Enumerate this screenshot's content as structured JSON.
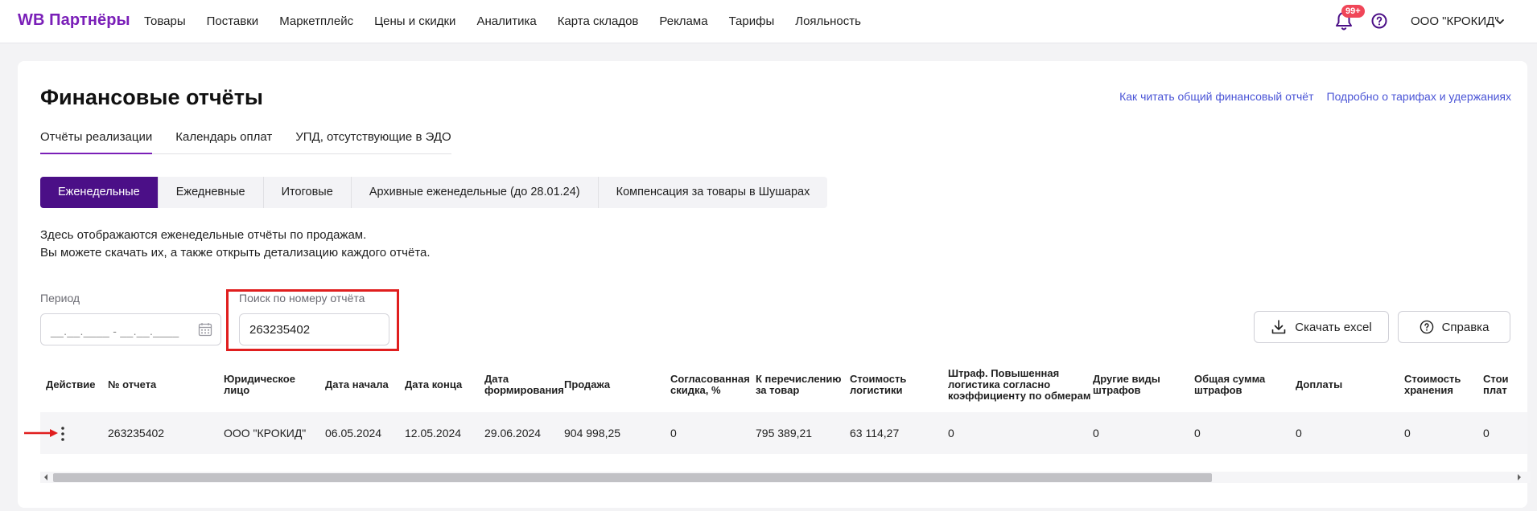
{
  "brand": "WB Партнёры",
  "nav": [
    "Товары",
    "Поставки",
    "Маркетплейс",
    "Цены и скидки",
    "Аналитика",
    "Карта складов",
    "Реклама",
    "Тарифы",
    "Лояльность"
  ],
  "header": {
    "notifications_badge": "99+",
    "account": "ООО \"КРОКИД\""
  },
  "page": {
    "title": "Финансовые отчёты",
    "links": [
      "Как читать общий финансовый отчёт",
      "Подробно о тарифах и удержаниях"
    ],
    "tabs": [
      "Отчёты реализации",
      "Календарь оплат",
      "УПД, отсутствующие в ЭДО"
    ],
    "segments": [
      "Еженедельные",
      "Ежедневные",
      "Итоговые",
      "Архивные еженедельные (до 28.01.24)",
      "Компенсация за товары в Шушарах"
    ],
    "description": [
      "Здесь отображаются еженедельные отчёты по продажам.",
      "Вы можете скачать их, а также открыть детализацию каждого отчёта."
    ]
  },
  "filters": {
    "period_label": "Период",
    "period_value": "__.__.____ - __.__.____",
    "search_label": "Поиск по номеру отчёта",
    "search_value": "263235402"
  },
  "buttons": {
    "download": "Скачать excel",
    "help": "Справка"
  },
  "table": {
    "headers": [
      [
        "Действие"
      ],
      [
        "№ отчета"
      ],
      [
        "Юридическое",
        "лицо"
      ],
      [
        "Дата начала"
      ],
      [
        "Дата конца"
      ],
      [
        "Дата",
        "формирования"
      ],
      [
        "Продажа"
      ],
      [
        "Согласованная",
        "скидка, %"
      ],
      [
        "К перечислению",
        "за товар"
      ],
      [
        "Стоимость",
        "логистики"
      ],
      [
        "Штраф. Повышенная",
        "логистика согласно",
        "коэффициенту по обмерам"
      ],
      [
        "Другие виды",
        "штрафов"
      ],
      [
        "Общая сумма",
        "штрафов"
      ],
      [
        "Доплаты"
      ],
      [
        "Стоимость",
        "хранения"
      ],
      [
        "Стои",
        "плат"
      ]
    ],
    "row": [
      "263235402",
      "ООО \"КРОКИД\"",
      "06.05.2024",
      "12.05.2024",
      "29.06.2024",
      "904 998,25",
      "0",
      "795 389,21",
      "63 114,27",
      "0",
      "0",
      "0",
      "0",
      "0",
      "0"
    ]
  },
  "colors": {
    "brand": "#7a1fb8",
    "accent": "#4b0f87",
    "link": "#4a54d6",
    "highlight": "#e01e1e",
    "badge": "#f04658"
  },
  "icons": [
    "bell-icon",
    "help-circle-icon",
    "chevron-down-icon",
    "calendar-icon",
    "download-icon",
    "question-icon",
    "more-vertical-icon",
    "red-arrow-icon"
  ]
}
